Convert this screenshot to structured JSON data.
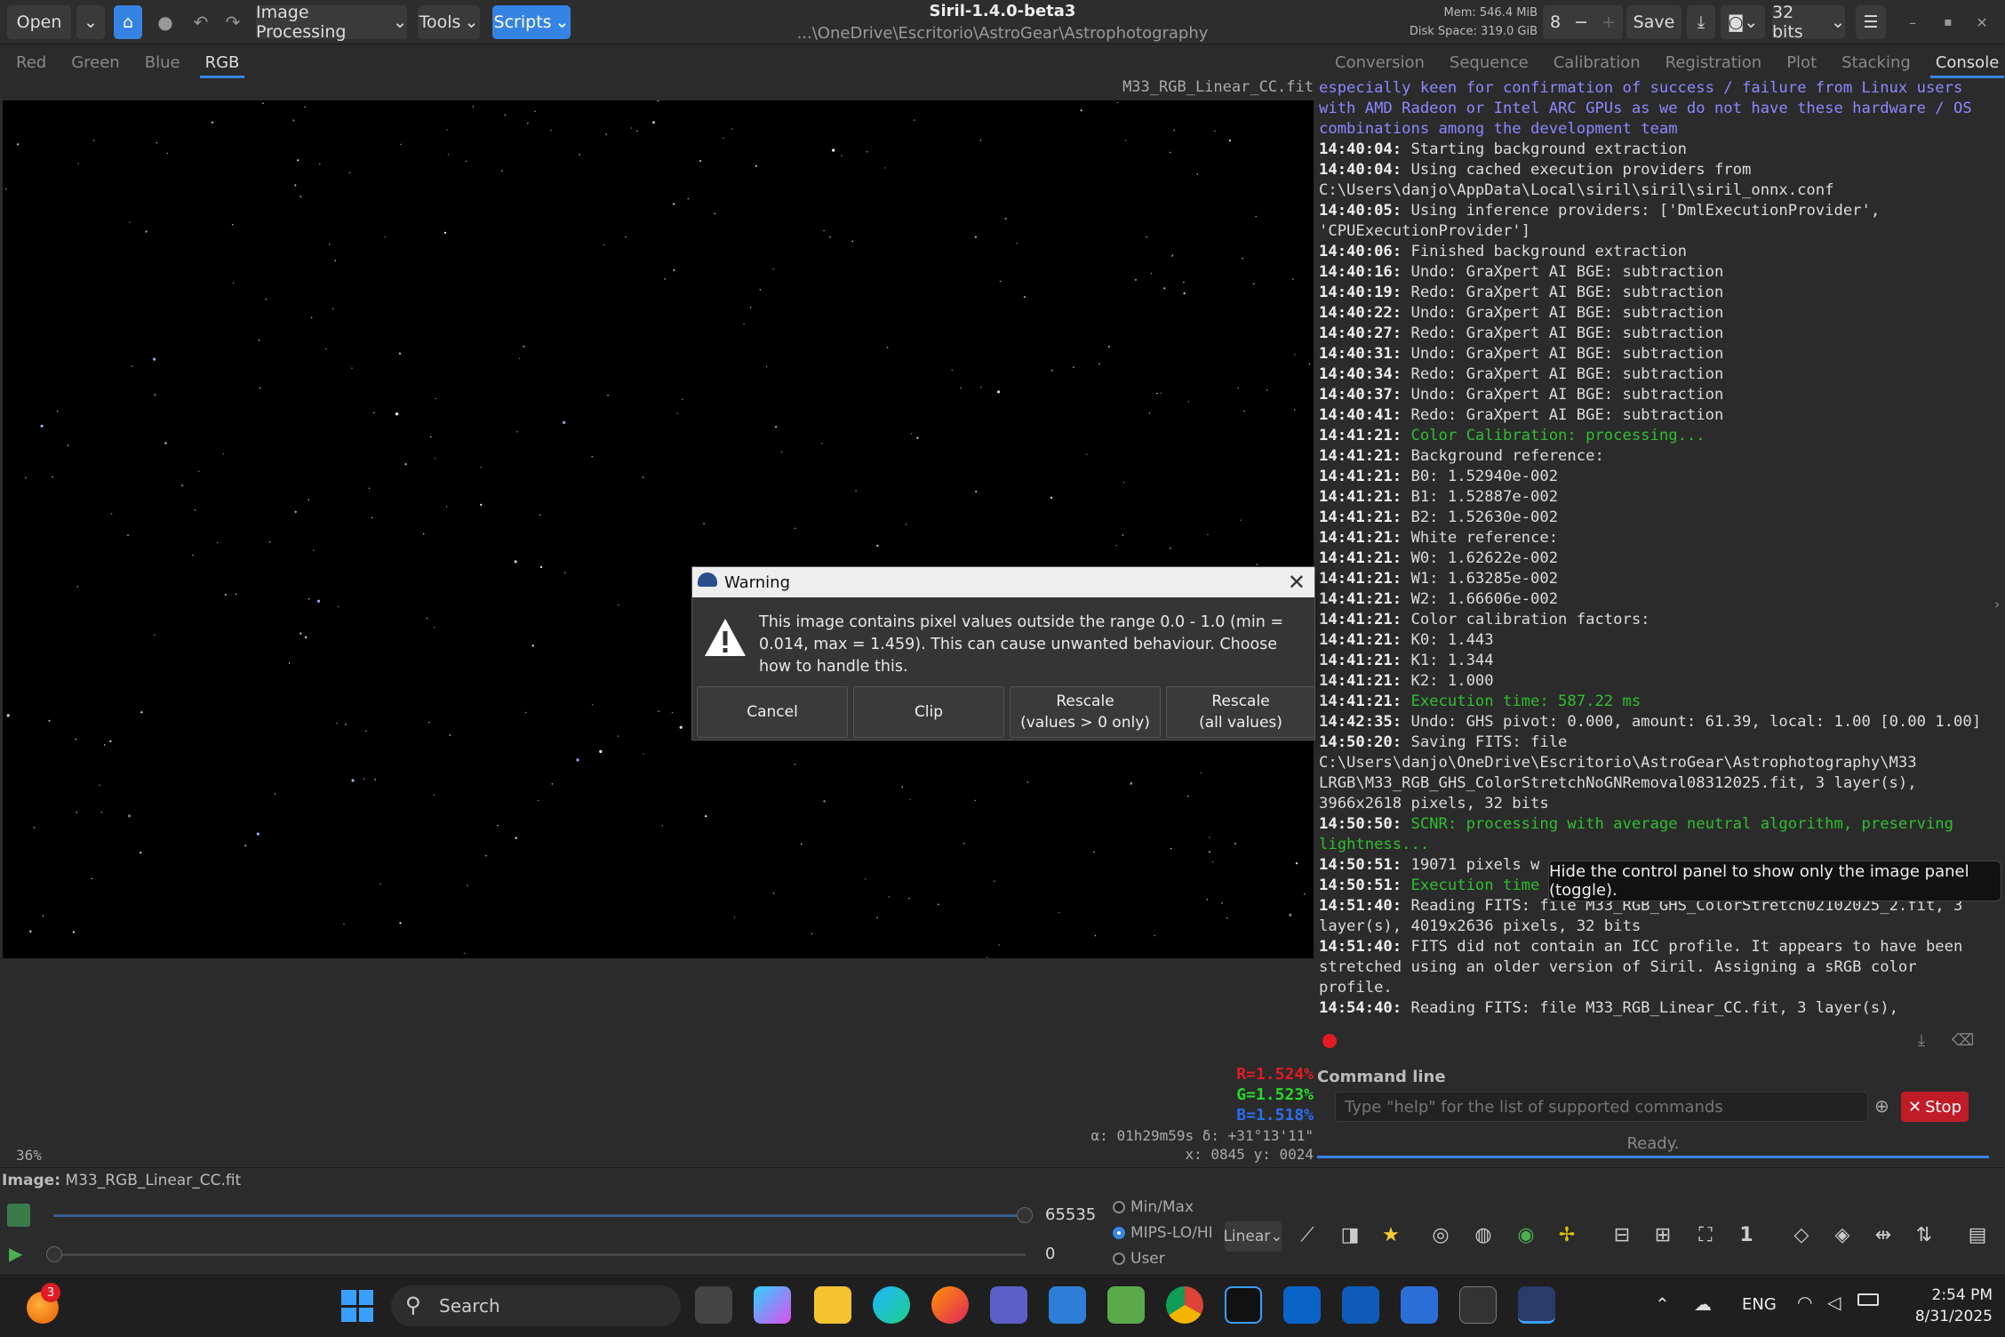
{
  "header": {
    "open_label": "Open",
    "image_processing": "Image Processing",
    "tools": "Tools",
    "scripts": "Scripts",
    "title": "Siril-1.4.0-beta3",
    "path": "...\\OneDrive\\Escritorio\\AstroGear\\Astrophotography",
    "mem": "Mem: 546.4 MiB",
    "disk": "Disk Space: 319.0 GiB",
    "spin_value": "8",
    "save_label": "Save",
    "bits_label": "32 bits"
  },
  "channel_tabs": [
    "Red",
    "Green",
    "Blue",
    "RGB"
  ],
  "right_tabs": [
    "Conversion",
    "Sequence",
    "Calibration",
    "Registration",
    "Plot",
    "Stacking",
    "Console"
  ],
  "image": {
    "name": "M33_RGB_Linear_CC.fit",
    "r": "R=1.524%",
    "g": "G=1.523%",
    "b": "B=1.518%",
    "alpha_delta": "α: 01h29m59s δ: +31°13'11\"",
    "xy": "x: 0845 y: 0024",
    "zoom": "36%"
  },
  "console": {
    "lines": [
      {
        "t": "",
        "m": "especially keen for confirmation of success / failure from Linux users with AMD Radeon or Intel ARC GPUs as we do not have these hardware / OS combinations among the development team",
        "c": "purple"
      },
      {
        "t": "14:40:04:",
        "m": " Starting background extraction",
        "c": ""
      },
      {
        "t": "14:40:04:",
        "m": " Using cached execution providers from C:\\Users\\danjo\\AppData\\Local\\siril\\siril\\siril_onnx.conf",
        "c": ""
      },
      {
        "t": "14:40:05:",
        "m": " Using inference providers: ['DmlExecutionProvider', 'CPUExecutionProvider']",
        "c": ""
      },
      {
        "t": "14:40:06:",
        "m": " Finished background extraction",
        "c": ""
      },
      {
        "t": "14:40:16:",
        "m": " Undo: GraXpert AI BGE: subtraction",
        "c": ""
      },
      {
        "t": "14:40:19:",
        "m": " Redo: GraXpert AI BGE: subtraction",
        "c": ""
      },
      {
        "t": "14:40:22:",
        "m": " Undo: GraXpert AI BGE: subtraction",
        "c": ""
      },
      {
        "t": "14:40:27:",
        "m": " Redo: GraXpert AI BGE: subtraction",
        "c": ""
      },
      {
        "t": "14:40:31:",
        "m": " Undo: GraXpert AI BGE: subtraction",
        "c": ""
      },
      {
        "t": "14:40:34:",
        "m": " Redo: GraXpert AI BGE: subtraction",
        "c": ""
      },
      {
        "t": "14:40:37:",
        "m": " Undo: GraXpert AI BGE: subtraction",
        "c": ""
      },
      {
        "t": "14:40:41:",
        "m": " Redo: GraXpert AI BGE: subtraction",
        "c": ""
      },
      {
        "t": "14:41:21:",
        "m": " Color Calibration: processing...",
        "c": "green"
      },
      {
        "t": "14:41:21:",
        "m": " Background reference:",
        "c": ""
      },
      {
        "t": "14:41:21:",
        "m": " B0: 1.52940e-002",
        "c": ""
      },
      {
        "t": "14:41:21:",
        "m": " B1: 1.52887e-002",
        "c": ""
      },
      {
        "t": "14:41:21:",
        "m": " B2: 1.52630e-002",
        "c": ""
      },
      {
        "t": "14:41:21:",
        "m": " White reference:",
        "c": ""
      },
      {
        "t": "14:41:21:",
        "m": " W0: 1.62622e-002",
        "c": ""
      },
      {
        "t": "14:41:21:",
        "m": " W1: 1.63285e-002",
        "c": ""
      },
      {
        "t": "14:41:21:",
        "m": " W2: 1.66606e-002",
        "c": ""
      },
      {
        "t": "14:41:21:",
        "m": " Color calibration factors:",
        "c": ""
      },
      {
        "t": "14:41:21:",
        "m": " K0: 1.443",
        "c": ""
      },
      {
        "t": "14:41:21:",
        "m": " K1: 1.344",
        "c": ""
      },
      {
        "t": "14:41:21:",
        "m": " K2: 1.000",
        "c": ""
      },
      {
        "t": "14:41:21:",
        "m": " Execution time: 587.22 ms",
        "c": "green"
      },
      {
        "t": "14:42:35:",
        "m": " Undo: GHS pivot: 0.000, amount: 61.39, local: 1.00 [0.00 1.00]",
        "c": ""
      },
      {
        "t": "14:50:20:",
        "m": " Saving FITS: file C:\\Users\\danjo\\OneDrive\\Escritorio\\AstroGear\\Astrophotography\\M33 LRGB\\M33_RGB_GHS_ColorStretchNoGNRemoval08312025.fit, 3 layer(s), 3966x2618 pixels, 32 bits",
        "c": ""
      },
      {
        "t": "14:50:50:",
        "m": " SCNR: processing with average neutral algorithm, preserving lightness...",
        "c": "green"
      },
      {
        "t": "14:50:51:",
        "m": " 19071 pixels w",
        "c": ""
      },
      {
        "t": "14:50:51:",
        "m": " Execution time",
        "c": "green"
      },
      {
        "t": "14:51:40:",
        "m": " Reading FITS: file M33_RGB_GHS_ColorStretch02102025_2.fit, 3 layer(s), 4019x2636 pixels, 32 bits",
        "c": ""
      },
      {
        "t": "14:51:40:",
        "m": " FITS did not contain an ICC profile. It appears to have been stretched using an older version of Siril. Assigning a sRGB color profile.",
        "c": ""
      },
      {
        "t": "14:54:40:",
        "m": " Reading FITS: file M33_RGB_Linear_CC.fit, 3 layer(s),",
        "c": ""
      }
    ]
  },
  "command": {
    "label": "Command line",
    "placeholder": "Type \"help\" for the list of supported commands",
    "stop": "Stop",
    "status": "Ready."
  },
  "bottom": {
    "image_label": "Image:",
    "image_name": "M33_RGB_Linear_CC.fit",
    "hi": "65535",
    "lo": "0",
    "minmax": "Min/Max",
    "mips": "MIPS-LO/HI",
    "user": "User",
    "scale": "Linear"
  },
  "dialog": {
    "title": "Warning",
    "message": "This image contains pixel values outside the range 0.0 - 1.0 (min = 0.014, max = 1.459). This can cause unwanted behaviour. Choose how to handle this.",
    "cancel": "Cancel",
    "clip": "Clip",
    "rescale_pos_1": "Rescale",
    "rescale_pos_2": "(values > 0 only)",
    "rescale_all_1": "Rescale",
    "rescale_all_2": "(all values)"
  },
  "tooltip": "Hide the control panel to show only the image panel (toggle).",
  "taskbar": {
    "badge": "3",
    "search": "Search",
    "lang": "ENG",
    "time": "2:54 PM",
    "date": "8/31/2025"
  }
}
